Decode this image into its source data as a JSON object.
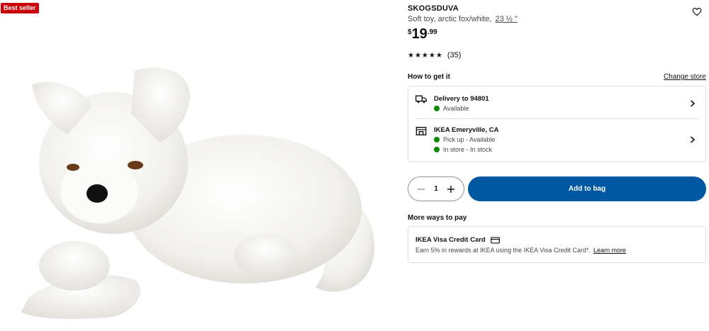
{
  "badge": "Best seller",
  "product": {
    "name": "SKOGSDUVA",
    "description": "Soft toy, arctic fox/white,",
    "size": "23 ½ \"",
    "price": {
      "currency": "$",
      "integer": "19",
      "decimal": ".99"
    },
    "rating": {
      "stars": 5,
      "count": "(35)"
    }
  },
  "availability": {
    "heading": "How to get it",
    "change_store": "Change store",
    "delivery": {
      "title": "Delivery to 94801",
      "status": "Available"
    },
    "store": {
      "title": "IKEA Emeryville, CA",
      "pickup": "Pick up - Available",
      "instore": "In store - In stock"
    }
  },
  "cart": {
    "quantity": "1",
    "add_label": "Add to bag"
  },
  "payment": {
    "heading": "More ways to pay",
    "card_title": "IKEA Visa Credit Card",
    "card_desc": "Earn 5% in rewards at IKEA using the IKEA Visa Credit Card*.",
    "learn_more": "Learn more"
  },
  "colors": {
    "brand_blue": "#0058a3",
    "badge_red": "#cc0008",
    "status_green": "#0a8a00"
  },
  "icons": [
    "heart-icon",
    "star-icon",
    "truck-icon",
    "store-icon",
    "chevron-right-icon",
    "minus-icon",
    "plus-icon",
    "credit-card-icon"
  ]
}
